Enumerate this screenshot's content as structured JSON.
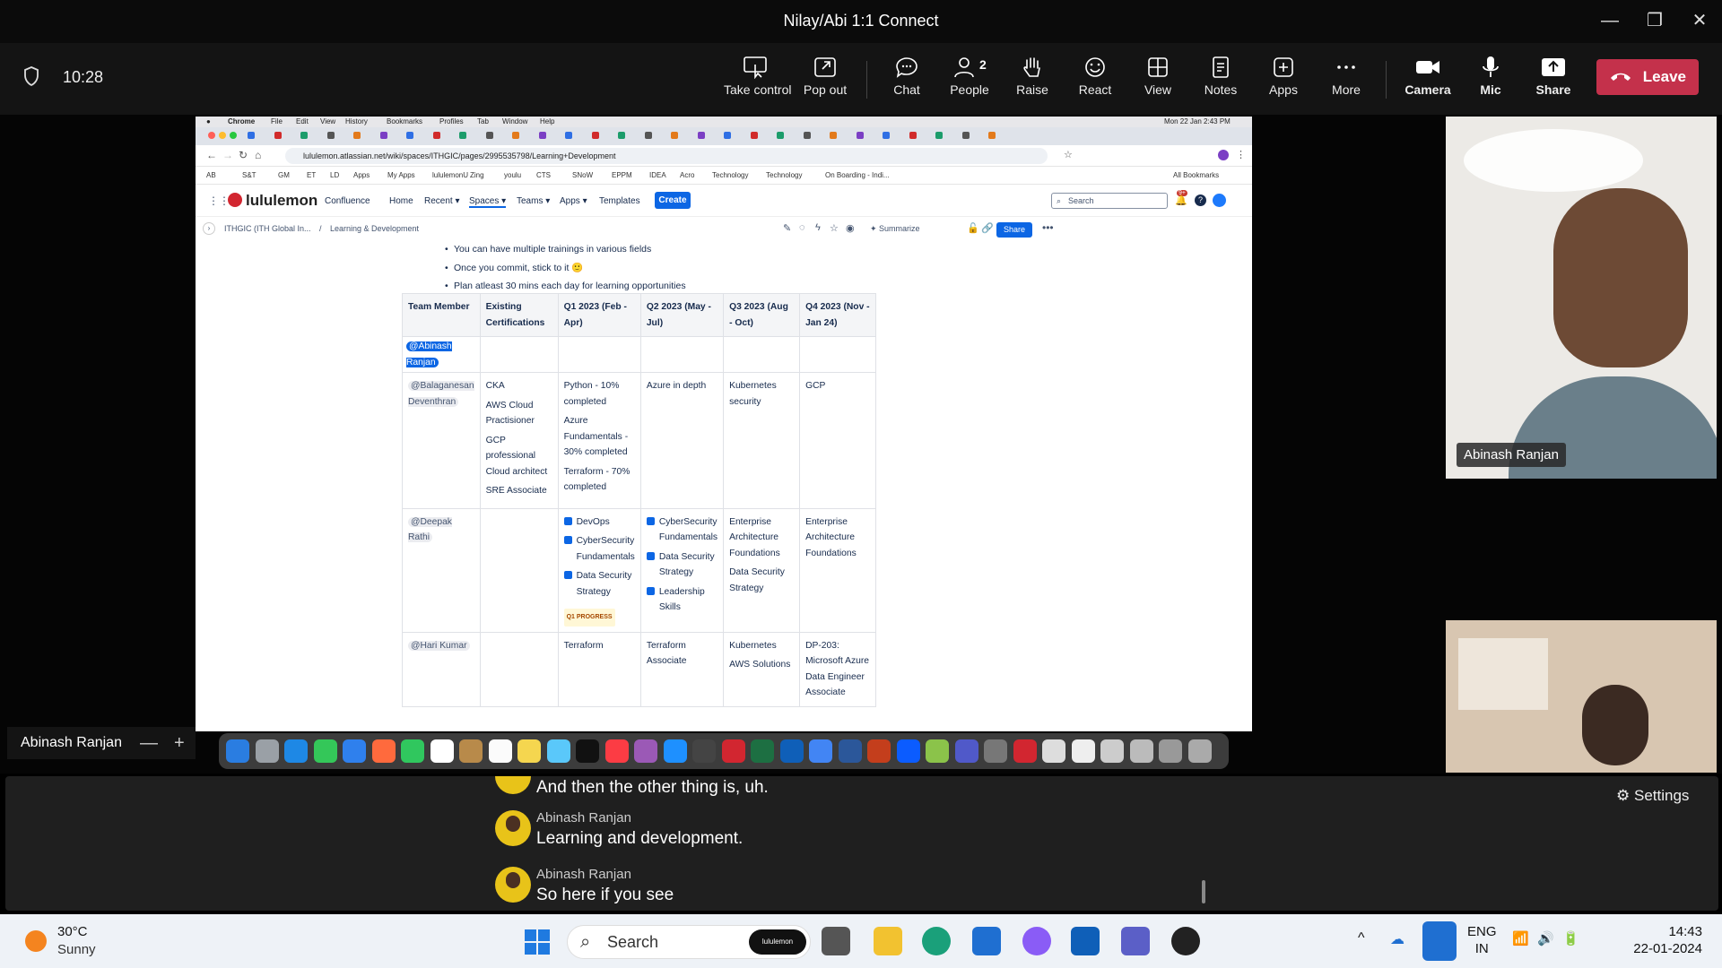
{
  "window": {
    "title": "Nilay/Abi 1:1 Connect"
  },
  "toolbar": {
    "timer": "10:28",
    "buttons": {
      "take_control": "Take control",
      "pop_out": "Pop out",
      "chat": "Chat",
      "people": "People",
      "people_count": "2",
      "raise": "Raise",
      "react": "React",
      "view": "View",
      "notes": "Notes",
      "apps": "Apps",
      "more": "More",
      "camera": "Camera",
      "mic": "Mic",
      "share": "Share",
      "leave": "Leave"
    },
    "leave_color": "#c4314b"
  },
  "shared_screen": {
    "mac_menu": [
      "Chrome",
      "File",
      "Edit",
      "View",
      "History",
      "Bookmarks",
      "Profiles",
      "Tab",
      "Window",
      "Help"
    ],
    "mac_clock": "Mon 22 Jan 2:43 PM",
    "url": "lululemon.atlassian.net/wiki/spaces/ITHGIC/pages/2995535798/Learning+Development",
    "bookmarks": [
      "AB",
      "S&T",
      "GM",
      "ET",
      "LD",
      "Apps",
      "My Apps",
      "lululemonU",
      "Zing",
      "youlu",
      "CTS",
      "SNoW",
      "EPPM",
      "IDEA",
      "Acro",
      "Technology",
      "Technology",
      "On Boarding - Indi...",
      "All Bookmarks"
    ],
    "confluence": {
      "brand": "lululemon",
      "nav": [
        "Confluence",
        "Home",
        "Recent",
        "Spaces",
        "Teams",
        "Apps",
        "Templates"
      ],
      "create": "Create",
      "search_placeholder": "Search",
      "notif_count": "9+",
      "breadcrumb_space": "ITHGIC (ITH Global In...",
      "breadcrumb_page": "Learning & Development",
      "summarize": "Summarize",
      "share": "Share"
    },
    "bullets": [
      "You can have multiple trainings in various fields",
      "Once you commit, stick to it 🙂",
      "Plan atleast 30 mins each day for learning opportunities"
    ],
    "table": {
      "headers": [
        "Team Member",
        "Existing Certifications",
        "Q1 2023 (Feb - Apr)",
        "Q2 2023 (May - Jul)",
        "Q3 2023 (Aug - Oct)",
        "Q4 2023 (Nov - Jan 24)"
      ],
      "row0_member": "@Abinash Ranjan",
      "row1": {
        "member": "@Balaganesan Deventhran",
        "certs": [
          "CKA",
          "AWS Cloud Practisioner",
          "GCP professional Cloud architect",
          "SRE Associate"
        ],
        "q1": [
          "Python - 10% completed",
          "Azure Fundamentals - 30% completed",
          "Terraform - 70% completed"
        ],
        "q2": "Azure in depth",
        "q3": "Kubernetes security",
        "q4": "GCP"
      },
      "row2": {
        "member": "@Deepak Rathi",
        "q1": [
          "DevOps",
          "CyberSecurity Fundamentals",
          "Data Security Strategy"
        ],
        "q1_status": "Q1 PROGRESS",
        "q2": [
          "CyberSecurity Fundamentals",
          "Data Security Strategy",
          "Leadership Skills"
        ],
        "q3": [
          "Enterprise Architecture Foundations",
          "Data Security Strategy"
        ],
        "q4": "Enterprise Architecture Foundations"
      },
      "row3": {
        "member": "@Hari Kumar",
        "q1": "Terraform",
        "q2": "Terraform Associate",
        "q3": [
          "Kubernetes",
          "AWS Solutions"
        ],
        "q4": "DP-203: Microsoft Azure Data Engineer Associate"
      }
    }
  },
  "participants": {
    "main_name": "Abinash Ranjan",
    "self_label": "Abinash Ranjan"
  },
  "captions": {
    "settings": "Settings",
    "lines": [
      {
        "speaker": "",
        "text": "And then the other thing is, uh."
      },
      {
        "speaker": "Abinash Ranjan",
        "text": "Learning and development."
      },
      {
        "speaker": "Abinash Ranjan",
        "text": "So here if you see"
      }
    ]
  },
  "taskbar": {
    "weather_temp": "30°C",
    "weather_cond": "Sunny",
    "search": "Search",
    "search_pill": "lululemon",
    "lang_top": "ENG",
    "lang_bottom": "IN",
    "time": "14:43",
    "date": "22-01-2024"
  }
}
